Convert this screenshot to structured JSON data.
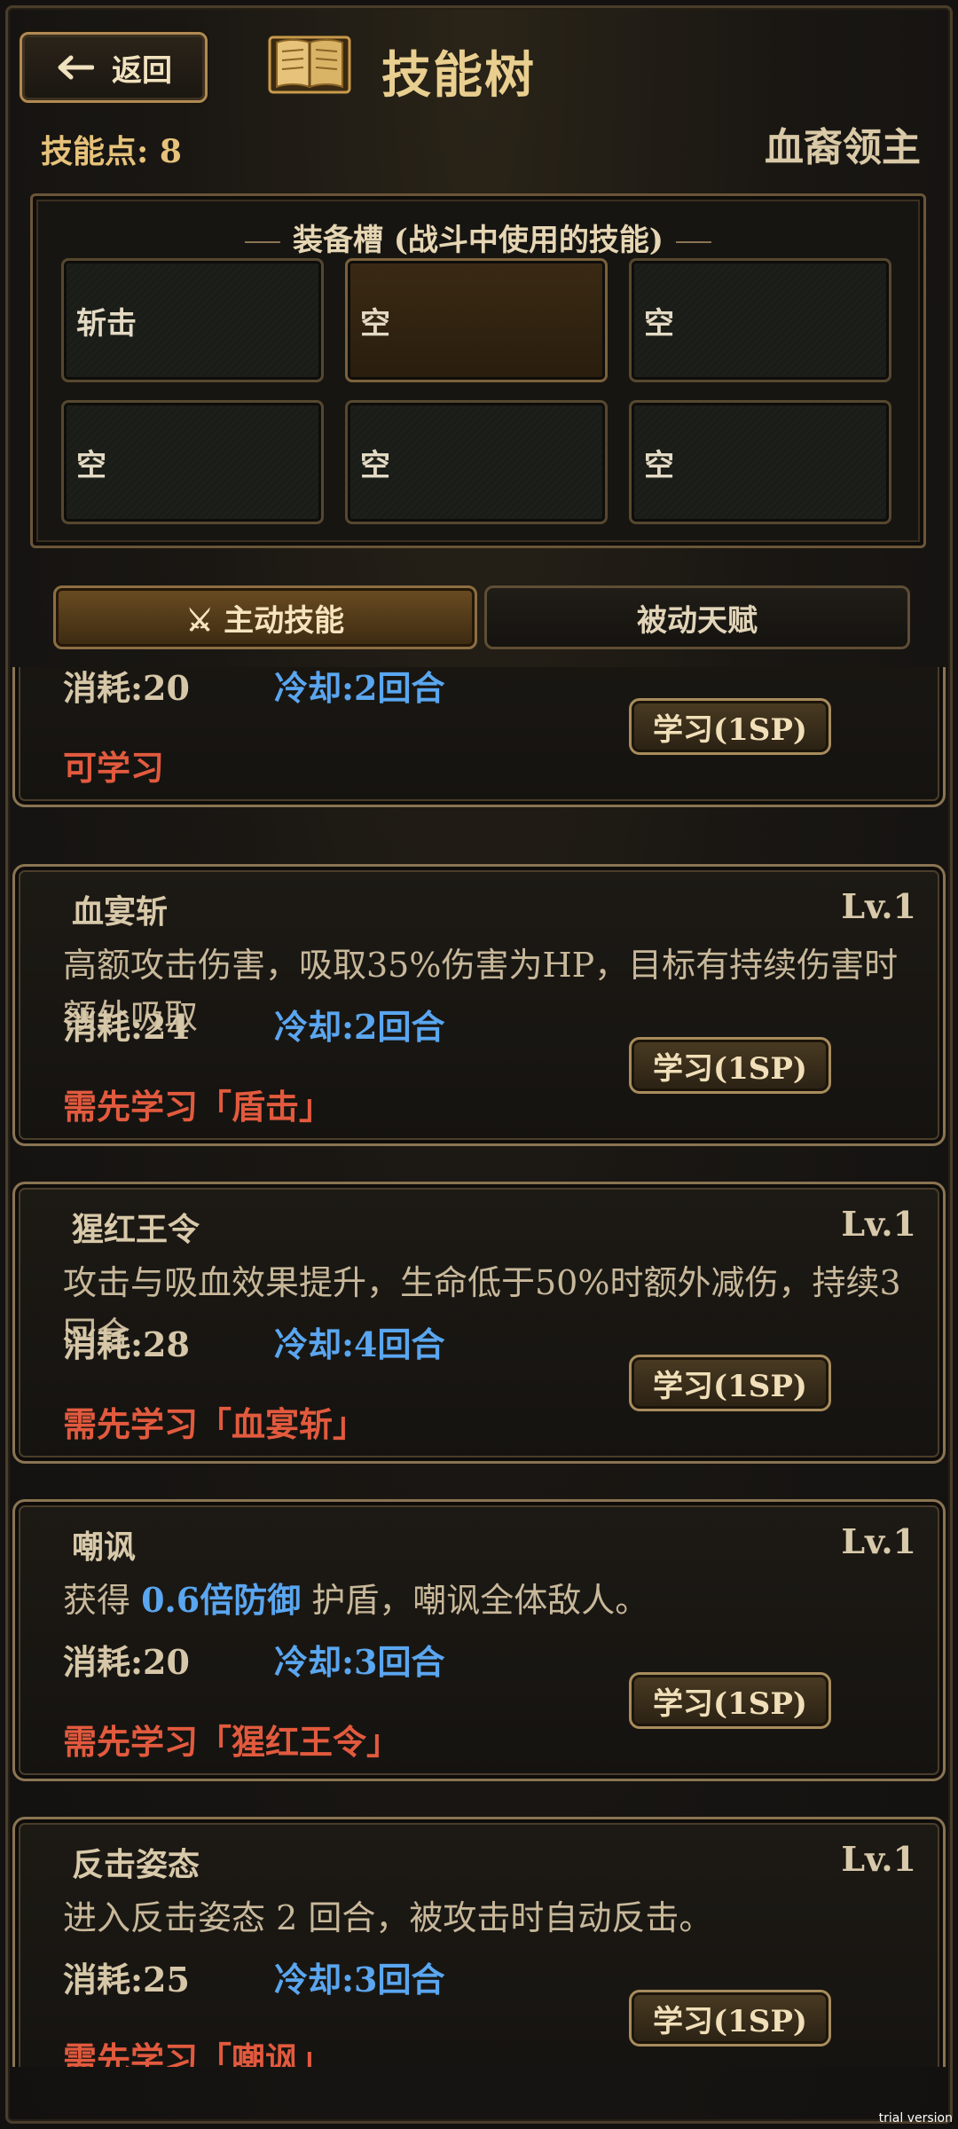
{
  "header": {
    "back_label": "返回",
    "title": "技能树",
    "skill_points": "技能点: 8",
    "class_name": "血裔领主"
  },
  "equip": {
    "title": "装备槽 (战斗中使用的技能)",
    "slots": [
      "斩击",
      "空",
      "空",
      "空",
      "空",
      "空"
    ]
  },
  "tabs": {
    "active": "⚔ 主动技能",
    "passive": "被动天赋"
  },
  "skills": [
    {
      "name": "",
      "level": "",
      "desc": "",
      "cost": "消耗:20",
      "cooldown": "冷却:2回合",
      "requirement": "可学习",
      "button": "学习(1SP)"
    },
    {
      "name": "血宴斩",
      "level": "Lv.1",
      "desc": "高额攻击伤害，吸取35%伤害为HP，目标有持续伤害时额外吸取",
      "cost": "消耗:24",
      "cooldown": "冷却:2回合",
      "requirement": "需先学习「盾击」",
      "button": "学习(1SP)"
    },
    {
      "name": "猩红王令",
      "level": "Lv.1",
      "desc": "攻击与吸血效果提升，生命低于50%时额外减伤，持续3回合",
      "cost": "消耗:28",
      "cooldown": "冷却:4回合",
      "requirement": "需先学习「血宴斩」",
      "button": "学习(1SP)"
    },
    {
      "name": "嘲讽",
      "level": "Lv.1",
      "desc_pre": "获得 ",
      "desc_hl": "0.6倍防御",
      "desc_post": " 护盾，嘲讽全体敌人。",
      "cost": "消耗:20",
      "cooldown": "冷却:3回合",
      "requirement": "需先学习「猩红王令」",
      "button": "学习(1SP)"
    },
    {
      "name": "反击姿态",
      "level": "Lv.1",
      "desc": "进入反击姿态 2 回合，被攻击时自动反击。",
      "cost": "消耗:25",
      "cooldown": "冷却:3回合",
      "requirement": "需先学习「嘲讽」",
      "button": "学习(1SP)"
    }
  ],
  "watermark": "trial version",
  "colors": {
    "accent_gold": "#e9cf8f",
    "cooldown_blue": "#5aa6f0",
    "requirement_red": "#e25a3e"
  }
}
